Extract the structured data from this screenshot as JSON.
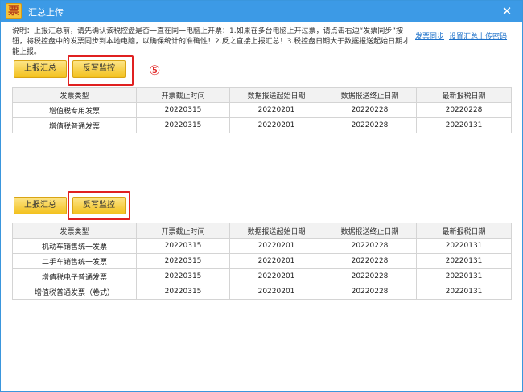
{
  "window": {
    "title": "汇总上传",
    "icon_glyph": "票",
    "close_glyph": "✕"
  },
  "description": "说明：上报汇总前，请先确认该税控盘是否一直在同一电脑上开票：1.如果在多台电脑上开过票，请点击右边“发票同步”按钮，将税控盘中的发票同步到本地电脑，以确保统计的准确性！2.反之直接上报汇总！3.税控盘日期大于数据报送起始日期才能上报。",
  "links": {
    "invoice_sync": "发票同步",
    "settings": "设置汇总上传密码"
  },
  "step_marker": "⑤",
  "sections": [
    {
      "report_button": "上报汇总",
      "monitor_button": "反写监控",
      "headers": [
        "发票类型",
        "开票截止时间",
        "数据报送起始日期",
        "数据报送终止日期",
        "最新报税日期"
      ],
      "rows": [
        [
          "增值税专用发票",
          "20220315",
          "20220201",
          "20220228",
          "20220228"
        ],
        [
          "增值税普通发票",
          "20220315",
          "20220201",
          "20220228",
          "20220131"
        ]
      ]
    },
    {
      "report_button": "上报汇总",
      "monitor_button": "反写监控",
      "headers": [
        "发票类型",
        "开票截止时间",
        "数据报送起始日期",
        "数据报送终止日期",
        "最新报税日期"
      ],
      "rows": [
        [
          "机动车销售统一发票",
          "20220315",
          "20220201",
          "20220228",
          "20220131"
        ],
        [
          "二手车销售统一发票",
          "20220315",
          "20220201",
          "20220228",
          "20220131"
        ],
        [
          "增值税电子普通发票",
          "20220315",
          "20220201",
          "20220228",
          "20220131"
        ],
        [
          "增值税普通发票（卷式）",
          "20220315",
          "20220201",
          "20220228",
          "20220131"
        ]
      ]
    }
  ],
  "colors": {
    "titlebar": "#3c9ae6",
    "button": "#f3c11e",
    "highlight": "#e02020",
    "link": "#1a6fc9"
  }
}
